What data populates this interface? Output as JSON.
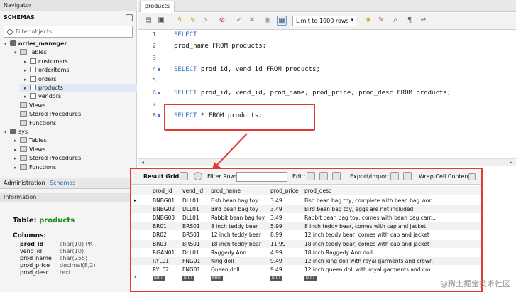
{
  "navigator": {
    "title": "Navigator",
    "schemas_label": "SCHEMAS",
    "filter_placeholder": "Filter objects",
    "tree": [
      {
        "label": "order_manager",
        "kind": "db",
        "bold": true
      },
      {
        "label": "Tables",
        "kind": "folder"
      },
      {
        "label": "customers",
        "kind": "table"
      },
      {
        "label": "orderitems",
        "kind": "table"
      },
      {
        "label": "orders",
        "kind": "table"
      },
      {
        "label": "products",
        "kind": "table"
      },
      {
        "label": "vendors",
        "kind": "table"
      },
      {
        "label": "Views",
        "kind": "folder"
      },
      {
        "label": "Stored Procedures",
        "kind": "folder"
      },
      {
        "label": "Functions",
        "kind": "folder"
      },
      {
        "label": "sys",
        "kind": "db"
      },
      {
        "label": "Tables",
        "kind": "folder"
      },
      {
        "label": "Views",
        "kind": "folder"
      },
      {
        "label": "Stored Procedures",
        "kind": "folder"
      },
      {
        "label": "Functions",
        "kind": "folder"
      }
    ],
    "bottom_tabs": [
      "Administration",
      "Schemas"
    ],
    "info_title": "Information",
    "table_label": "Table:",
    "table_name": "products",
    "columns_label": "Columns:",
    "columns": [
      {
        "name": "prod_id",
        "type": "char(10) PK"
      },
      {
        "name": "vend_id",
        "type": "char(10)"
      },
      {
        "name": "prod_name",
        "type": "char(255)"
      },
      {
        "name": "prod_price",
        "type": "decimal(8,2)"
      },
      {
        "name": "prod_desc",
        "type": "text"
      }
    ]
  },
  "query_tab": "products",
  "limit_select": "Limit to 1000 rows",
  "editor_lines": [
    {
      "n": "1",
      "kw": "SELECT",
      "rest": ""
    },
    {
      "n": "2",
      "kw": "",
      "rest": "prod_name FROM products;"
    },
    {
      "n": "3",
      "kw": "",
      "rest": ""
    },
    {
      "n": "4",
      "kw": "SELECT",
      "rest": " prod_id, vend_id FROM products;"
    },
    {
      "n": "5",
      "kw": "",
      "rest": ""
    },
    {
      "n": "6",
      "kw": "SELECT",
      "rest": " prod_id, vend_id, prod_name, prod_price, prod_desc FROM products;"
    },
    {
      "n": "7",
      "kw": "",
      "rest": ""
    },
    {
      "n": "8",
      "kw": "SELECT",
      "rest": " * FROM products;"
    }
  ],
  "results": {
    "result_grid": "Result Grid",
    "filter_rows": "Filter Rows:",
    "edit": "Edit:",
    "export_import": "Export/Import:",
    "wrap": "Wrap Cell Content:",
    "columns": [
      "prod_id",
      "vend_id",
      "prod_name",
      "prod_price",
      "prod_desc"
    ],
    "rows": [
      [
        "BNBG01",
        "DLL01",
        "Fish bean bag toy",
        "3.49",
        "Fish bean bag toy, complete with bean bag wor..."
      ],
      [
        "BNBG02",
        "DLL01",
        "Bird bean bag toy",
        "3.49",
        "Bird bean bag toy, eggs are not included"
      ],
      [
        "BNBG03",
        "DLL01",
        "Rabbit bean bag toy",
        "3.49",
        "Rabbit bean bag toy, comes with bean bag carr..."
      ],
      [
        "BR01",
        "BRS01",
        "8 inch teddy bear",
        "5.99",
        "8 inch teddy bear, comes with cap and jacket"
      ],
      [
        "BR02",
        "BRS01",
        "12 inch teddy bear",
        "8.99",
        "12 inch teddy bear, comes with cap and jacket"
      ],
      [
        "BR03",
        "BRS01",
        "18 inch teddy bear",
        "11.99",
        "18 inch teddy bear, comes with cap and jacket"
      ],
      [
        "RGAN01",
        "DLL01",
        "Raggedy Ann",
        "4.99",
        "18 inch Raggedy Ann doll"
      ],
      [
        "RYL01",
        "FNG01",
        "King doll",
        "9.49",
        "12 inch king doll with royal garments and crown"
      ],
      [
        "RYL02",
        "FNG01",
        "Queen doll",
        "9.49",
        "12 inch queen doll with royal garments and cro..."
      ]
    ],
    "null_label": "NULL"
  },
  "watermark": "@稀土掘金技术社区",
  "colors": {
    "highlight": "#e53935",
    "keyword": "#2c6fc4",
    "table_name": "#1a8c1a"
  }
}
